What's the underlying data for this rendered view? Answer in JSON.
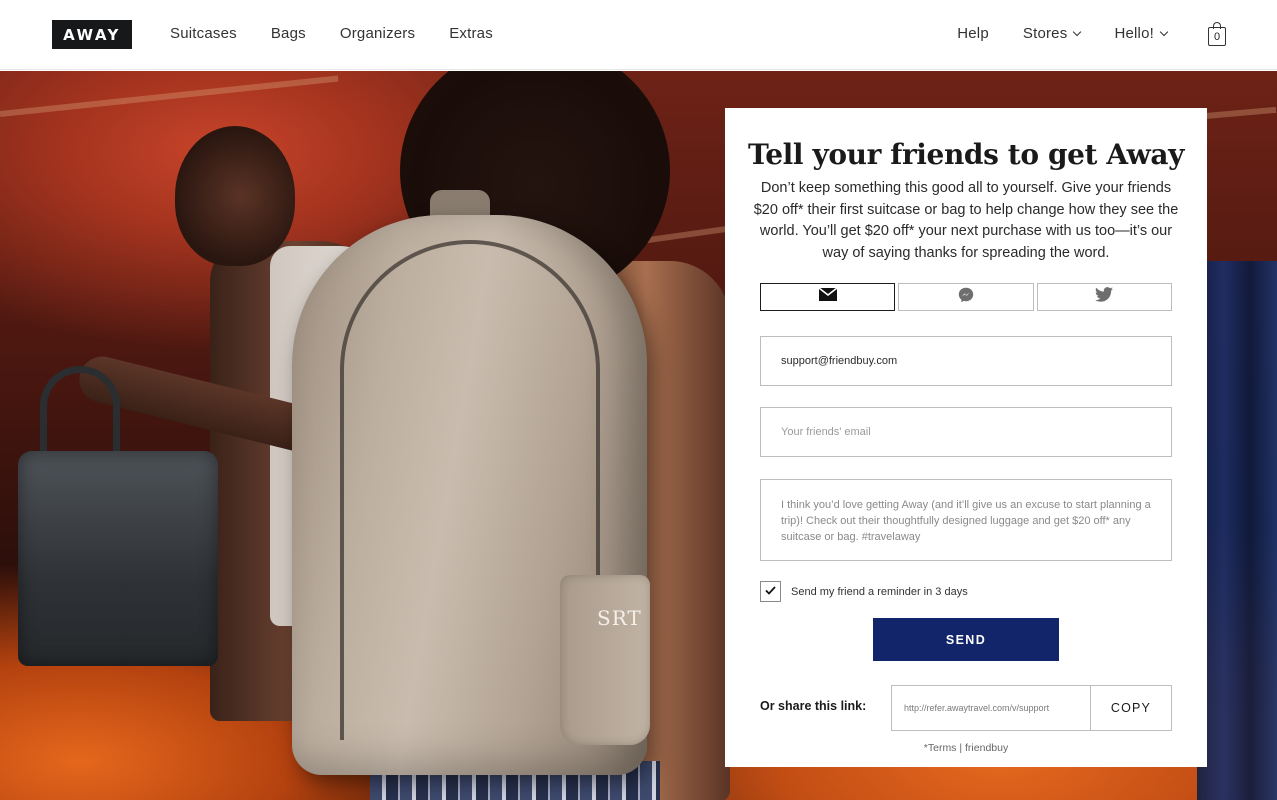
{
  "header": {
    "logo_text": "AWAY",
    "nav_left": [
      "Suitcases",
      "Bags",
      "Organizers",
      "Extras"
    ],
    "nav_right": {
      "help": "Help",
      "stores": "Stores",
      "account": "Hello!"
    },
    "cart_count": "0"
  },
  "hero": {
    "monogram": "SRT"
  },
  "referral": {
    "title": "Tell your friends to get Away",
    "description": "Don’t keep something this good all to yourself. Give your friends $20 off* their first suitcase or bag to help change how they see the world. You’ll get $20 off* your next purchase with us too—it’s our way of saying thanks for spreading the word.",
    "share_tabs": [
      {
        "icon": "envelope-icon",
        "active": true
      },
      {
        "icon": "messenger-icon",
        "active": false
      },
      {
        "icon": "twitter-icon",
        "active": false
      }
    ],
    "from_email": "support@friendbuy.com",
    "to_email_placeholder": "Your friends’ email",
    "message": "I think you’d love getting Away (and it’ll give us an excuse to start planning a trip)! Check out their thoughtfully designed luggage and get  $20 off* any suitcase or bag. #travelaway",
    "reminder_label": "Send my friend a reminder in 3 days",
    "reminder_checked": true,
    "send_label": "SEND",
    "share_link_label": "Or share this link:",
    "share_link": "http://refer.awaytravel.com/v/support",
    "copy_label": "COPY",
    "terms_label": "*Terms",
    "terms_separator": "|",
    "provider_label": "friendbuy"
  },
  "colors": {
    "send_button": "#12246a",
    "logo_bg": "#17181a"
  }
}
